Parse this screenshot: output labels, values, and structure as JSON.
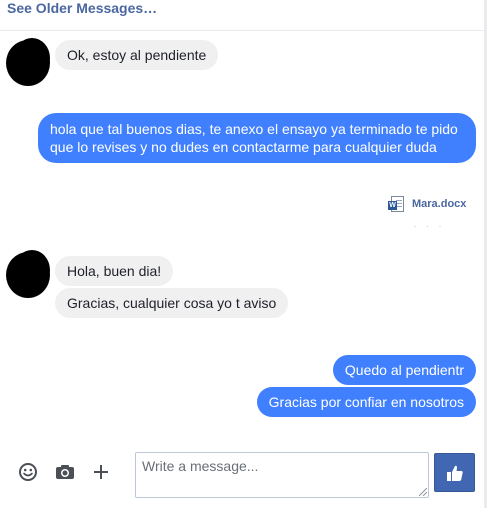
{
  "header": {
    "see_older": "See Older Messages…"
  },
  "messages": [
    {
      "direction": "in",
      "text": "Ok, estoy al pendiente"
    },
    {
      "direction": "out",
      "text": "hola que tal buenos dias, te anexo el ensayo ya terminado te pido que lo revises y no dudes en contactarme para cualquier duda"
    },
    {
      "direction": "out",
      "attachment": {
        "name": "Mara.docx",
        "icon": "word-document-icon"
      }
    },
    {
      "direction": "in",
      "text": "Hola, buen dia!"
    },
    {
      "direction": "in",
      "text": "Gracias, cualquier cosa yo t aviso"
    },
    {
      "direction": "out",
      "text": "Quedo al pendientr"
    },
    {
      "direction": "out",
      "text": "Gracias por confiar en nosotros"
    }
  ],
  "composer": {
    "placeholder": "Write a message...",
    "value": "",
    "icons": [
      "emoji-icon",
      "camera-icon",
      "plus-icon",
      "thumbs-up-icon"
    ]
  },
  "colors": {
    "outgoing_bubble": "#4080ff",
    "incoming_bubble": "#f1f0f0",
    "link": "#4b67a1",
    "like_button": "#4267b2"
  }
}
